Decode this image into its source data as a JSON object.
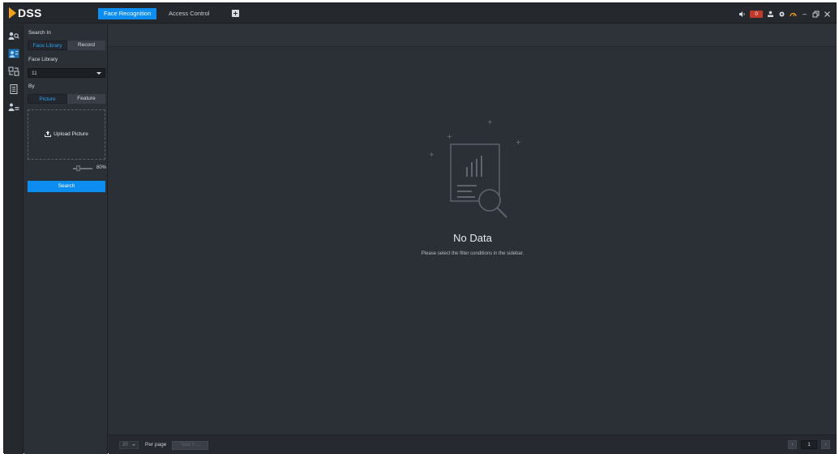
{
  "app": {
    "logo_text": "DSS"
  },
  "tabs": [
    {
      "label": "Face Recognition",
      "active": true
    },
    {
      "label": "Access Control",
      "active": false
    }
  ],
  "tray": {
    "alarm_count": "0"
  },
  "rail": {
    "items": [
      "face-search",
      "face-library",
      "face-compare",
      "records",
      "person-config"
    ]
  },
  "panel": {
    "search_in_label": "Search In",
    "search_in_options": [
      "Face Library",
      "Record"
    ],
    "face_library_label": "Face Library",
    "face_library_value": "11",
    "by_label": "By",
    "by_options": [
      "Picture",
      "Feature"
    ],
    "upload_label": "Upload Picture",
    "similarity_value": "80%",
    "similarity_level": 0.8,
    "search_button": "Search"
  },
  "main": {
    "empty_title": "No Data",
    "empty_subtitle": "Please select the filter conditions in the sidebar."
  },
  "footer": {
    "per_page_value": "20",
    "per_page_label": "Per page",
    "total_label": "Total 0 ...",
    "current_page": "1"
  },
  "colors": {
    "accent": "#0d8df0",
    "background": "#2b2f36",
    "alarm": "#c0392b",
    "logo": "#f2a21b"
  }
}
